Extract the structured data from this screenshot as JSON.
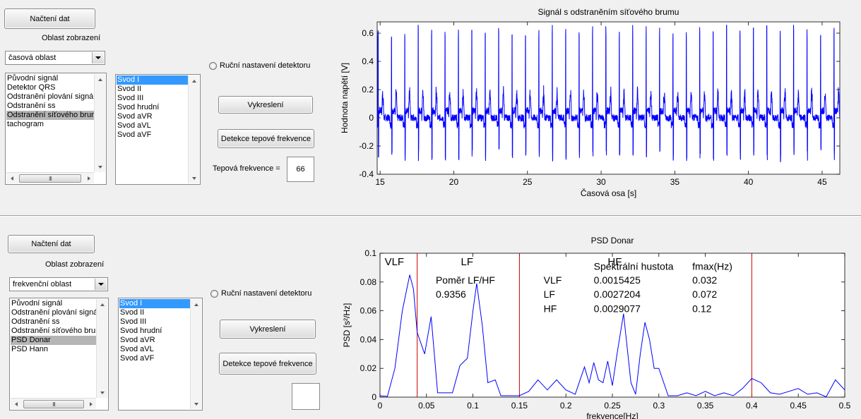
{
  "top": {
    "load_button": "Načtení dat",
    "area_label": "Oblast  zobrazení",
    "area_select": "časová oblast",
    "signal_list": [
      "Původní signál",
      "Detektor QRS",
      "Odstranění plování signálu",
      "Odstranění ss",
      "Odstranění síťového brum",
      "tachogram"
    ],
    "signal_selected": 4,
    "lead_list": [
      "Svod I",
      "Svod II",
      "Svod III",
      "Svod hrudní",
      "Svod aVR",
      "Svod aVL",
      "Svod aVF"
    ],
    "lead_selected": 0,
    "manual_detector": "Ruční nastavení detektoru",
    "draw_button": "Vykreslení",
    "detect_button": "Detekce tepové frekvence",
    "heart_rate_label": "Tepová frekvence =",
    "heart_rate_value": "66",
    "scroll_grip": "III"
  },
  "bottom": {
    "load_button": "Načtení dat",
    "area_label": "Oblast zobrazení",
    "area_select": "frekvenční oblast",
    "signal_list": [
      "Původní signál",
      "Odstranění plování signál",
      "Odstranění ss",
      "Odstranění síťového brum",
      "PSD Donar",
      "PSD Hann"
    ],
    "signal_selected": 4,
    "lead_list": [
      "Svod I",
      "Svod II",
      "Svod III",
      "Svod hrudní",
      "Svod aVR",
      "Svod aVL",
      "Svod aVF"
    ],
    "lead_selected": 0,
    "manual_detector": "Ruční nastavení detektoru",
    "draw_button": "Vykreslení",
    "detect_button": "Detekce tepové frekvence",
    "heart_rate_value": "",
    "scroll_grip": "III"
  },
  "colors": {
    "signal": "#0000ff",
    "band_line": "#cc0000"
  },
  "chart_data": [
    {
      "type": "line",
      "title": "Signál s odstraněním síťového brumu",
      "xlabel": "Časová osa [s]",
      "ylabel": "Hodnota napětí [V]",
      "xlim": [
        14.8,
        46.2
      ],
      "ylim": [
        -0.4,
        0.68
      ],
      "xticks": [
        15,
        20,
        25,
        30,
        35,
        40,
        45
      ],
      "yticks": [
        -0.4,
        -0.2,
        0,
        0.2,
        0.4,
        0.6
      ],
      "ytick_labels": [
        "-0.4",
        "-0.2",
        "0",
        "0.2",
        "0.4",
        "0.6"
      ],
      "series": [
        {
          "beat_interval_s": 0.91,
          "r_peak": 0.66,
          "s_trough": -0.3,
          "baseline": 0.0
        }
      ]
    },
    {
      "type": "line",
      "title": "PSD Donar",
      "xlabel": "frekvence[Hz]",
      "ylabel": "PSD [s²/Hz]",
      "xlim": [
        0,
        0.5
      ],
      "ylim": [
        0,
        0.1
      ],
      "xticks": [
        0,
        0.05,
        0.1,
        0.15,
        0.2,
        0.25,
        0.3,
        0.35,
        0.4,
        0.45,
        0.5
      ],
      "xtick_labels": [
        "0",
        "0.05",
        "0.1",
        "0.15",
        "0.2",
        "0.25",
        "0.3",
        "0.35",
        "0.4",
        "0.45",
        "0.5"
      ],
      "yticks": [
        0,
        0.02,
        0.04,
        0.06,
        0.08,
        0.1
      ],
      "ytick_labels": [
        "0",
        "0.02",
        "0.04",
        "0.06",
        "0.08",
        "0.1"
      ],
      "band_lines": [
        0.04,
        0.15,
        0.4
      ],
      "band_labels": [
        "VLF",
        "LF",
        "HF"
      ],
      "ratio_label": "Poměr LF/HF",
      "ratio_value": "0.9356",
      "table_headers": [
        "Spektrální hustota",
        "fmax(Hz)"
      ],
      "table_rows": [
        {
          "band": "VLF",
          "psd": "0.0015425",
          "fmax": "0.032"
        },
        {
          "band": "LF",
          "psd": "0.0027204",
          "fmax": "0.072"
        },
        {
          "band": "HF",
          "psd": "0.0029077",
          "fmax": "0.12"
        }
      ],
      "series": [
        {
          "x": [
            0,
            0.008,
            0.016,
            0.024,
            0.032,
            0.036,
            0.04,
            0.048,
            0.055,
            0.062,
            0.07,
            0.078,
            0.086,
            0.094,
            0.1,
            0.104,
            0.11,
            0.116,
            0.124,
            0.13,
            0.14,
            0.15,
            0.16,
            0.17,
            0.18,
            0.19,
            0.2,
            0.21,
            0.22,
            0.225,
            0.23,
            0.235,
            0.24,
            0.245,
            0.25,
            0.255,
            0.262,
            0.27,
            0.275,
            0.28,
            0.285,
            0.29,
            0.295,
            0.3,
            0.31,
            0.32,
            0.33,
            0.34,
            0.35,
            0.36,
            0.37,
            0.38,
            0.39,
            0.4,
            0.41,
            0.42,
            0.43,
            0.44,
            0.45,
            0.46,
            0.47,
            0.48,
            0.49,
            0.5
          ],
          "y": [
            0.001,
            0.0005,
            0.02,
            0.06,
            0.085,
            0.075,
            0.045,
            0.03,
            0.056,
            0.003,
            0.003,
            0.003,
            0.022,
            0.027,
            0.06,
            0.079,
            0.05,
            0.01,
            0.012,
            0.001,
            0.001,
            0.001,
            0.004,
            0.012,
            0.005,
            0.012,
            0.005,
            0.002,
            0.021,
            0.01,
            0.024,
            0.012,
            0.01,
            0.025,
            0.008,
            0.03,
            0.058,
            0.01,
            0.002,
            0.03,
            0.052,
            0.04,
            0.02,
            0.02,
            0.001,
            0.001,
            0.003,
            0.001,
            0.004,
            0.001,
            0.003,
            0.001,
            0.006,
            0.013,
            0.01,
            0.003,
            0.002,
            0.004,
            0.006,
            0.002,
            0.003,
            0.0002,
            0.012,
            0.005
          ]
        }
      ]
    }
  ]
}
